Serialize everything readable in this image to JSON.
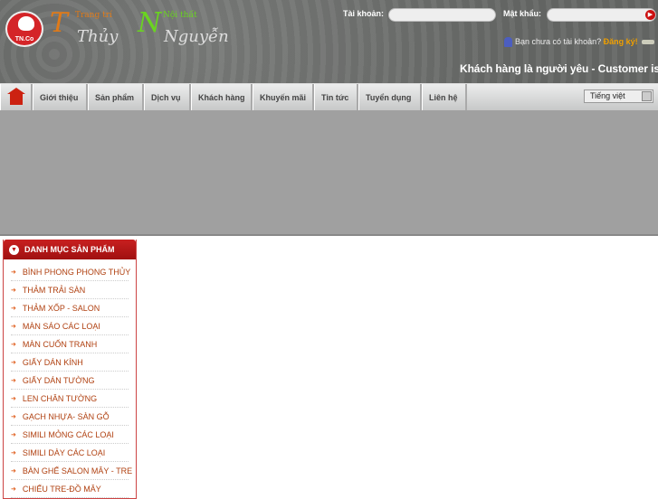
{
  "header": {
    "logo": {
      "badge": "TN.Co",
      "line1": "Trang trí",
      "line2": "Nội thất",
      "name1": "Thủy",
      "name2": "Nguyễn"
    },
    "account_label": "Tài khoản:",
    "account_value": "",
    "password_label": "Mật khẩu:",
    "password_value": "",
    "no_account_text": "Bạn chưa có tài khoản?",
    "register_link": "Đăng ký!",
    "slogan": "Khách hàng là người yêu - Customer is"
  },
  "nav": {
    "items": [
      "Giới thiệu",
      "Sản phẩm",
      "Dịch vụ",
      "Khách hàng",
      "Khuyến mãi",
      "Tin tức",
      "Tuyển dụng",
      "Liên hệ"
    ],
    "language": "Tiếng việt"
  },
  "sidebar": {
    "title": "DANH MỤC SẢN PHẨM",
    "items": [
      "BÌNH PHONG PHONG THỦY",
      "THẢM TRẢI SÀN",
      "THẢM XỐP - SALON",
      "MÀN SÁO CÁC LOẠI",
      "MÀN CUỐN TRANH",
      "GIẤY DÁN KÍNH",
      "GIẤY DÁN TƯỜNG",
      "LEN CHÂN TƯỜNG",
      "GẠCH NHỰA- SÀN GỖ",
      "SIMILI MỎNG CÁC LOẠI",
      "SIMILI DÀY CÁC LOẠI",
      "BÀN GHẾ SALON MÂY - TRE",
      "CHIẾU TRE-ĐỒ MÂY"
    ]
  },
  "colors": {
    "accent": "#b01818",
    "link": "#b04010",
    "register": "#f0a000"
  }
}
